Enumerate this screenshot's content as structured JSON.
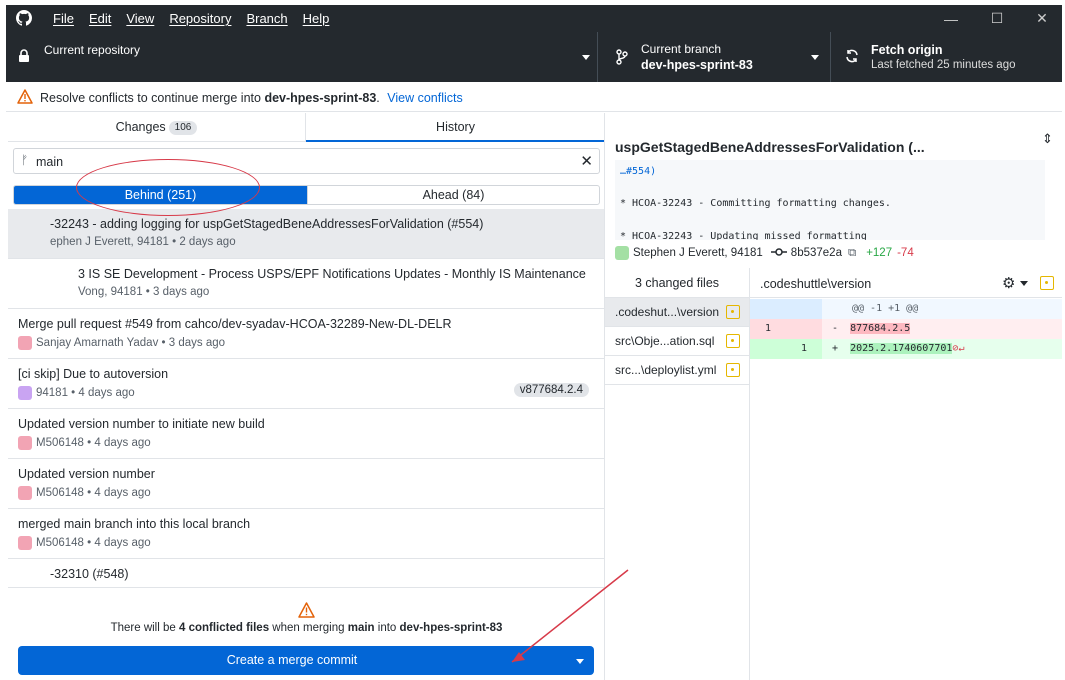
{
  "menu": [
    "File",
    "Edit",
    "View",
    "Repository",
    "Branch",
    "Help"
  ],
  "window_controls": {
    "minimize": "—",
    "maximize": "☐",
    "close": "✕"
  },
  "toolbar": {
    "repo_label": "Current repository",
    "repo_value": "",
    "branch_label": "Current branch",
    "branch_value": "dev-hpes-sprint-83",
    "fetch_label": "Fetch origin",
    "fetch_sub": "Last fetched 25 minutes ago"
  },
  "banner": {
    "text_prefix": "Resolve conflicts to continue merge into",
    "branch": "dev-hpes-sprint-83",
    "dot": ".",
    "link": "View conflicts"
  },
  "tabs": {
    "changes": "Changes",
    "changes_count": "106",
    "history": "History"
  },
  "filter": {
    "value": "main",
    "branch_icon": "ᚠ"
  },
  "segment": {
    "behind": "Behind (251)",
    "ahead": "Ahead (84)"
  },
  "commits": [
    {
      "title": "-32243 - adding logging for uspGetStagedBeneAddressesForValidation (#554)",
      "meta": "ephen J Everett, 94181 • 2 days ago"
    },
    {
      "title": "3 IS SE Development - Process USPS/EPF Notifications Updates - Monthly IS Maintenance T...",
      "meta": "Vong, 94181 • 3 days ago"
    },
    {
      "title": "Merge pull request #549 from cahco/dev-syadav-HCOA-32289-New-DL-DELR",
      "meta": "Sanjay Amarnath Yadav • 3 days ago"
    },
    {
      "title": "[ci skip] Due to autoversion",
      "meta": "94181 • 4 days ago",
      "tag": "v877684.2.4"
    },
    {
      "title": "Updated version number to initiate new build",
      "meta": "M506148 • 4 days ago"
    },
    {
      "title": "Updated version number",
      "meta": "M506148 • 4 days ago"
    },
    {
      "title": "merged main branch into this local branch",
      "meta": "M506148 • 4 days ago"
    },
    {
      "title": "-32310 (#548)",
      "meta": ""
    }
  ],
  "merge": {
    "pre": "There will be",
    "count": "4 conflicted files",
    "mid": "when merging",
    "from": "main",
    "into": "into",
    "to": "dev-hpes-sprint-83",
    "button": "Create a merge commit"
  },
  "detail": {
    "title": "uspGetStagedBeneAddressesForValidation (...",
    "body": [
      "…#554)",
      "* HCOA-32243 - Committing formatting changes.",
      "* HCOA-32243 - Updating missed formatting"
    ],
    "author": "Stephen J Everett, 94181",
    "sha": "8b537e2a",
    "additions": "+127",
    "deletions": "-74",
    "files_header": "3 changed files",
    "files": [
      ".codeshut...\\version",
      "src\\Obje...ation.sql",
      "src...\\deploylist.yml"
    ],
    "diff_path": ".codeshuttle\\version",
    "hunk": "@@ -1 +1 @@",
    "del_line_no": "1",
    "del_text": "877684.2.5",
    "add_line_no": "1",
    "add_text": "2025.2.1740607701"
  },
  "colors": {
    "accent": "#0366d6",
    "titlebar": "#24292e",
    "annotation": "#d73a49",
    "warning": "#e36209"
  }
}
